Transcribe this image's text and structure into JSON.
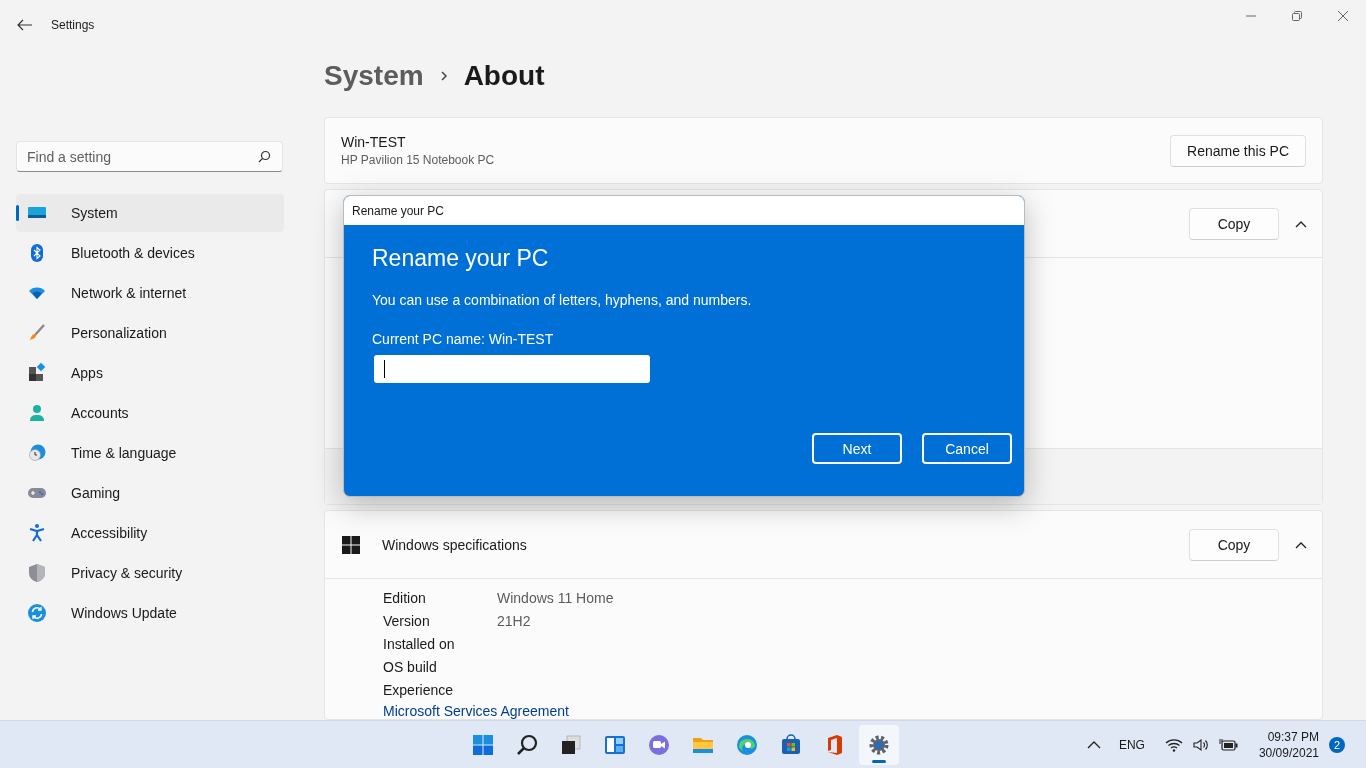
{
  "window": {
    "title": "Settings"
  },
  "search": {
    "placeholder": "Find a setting"
  },
  "sidebar": {
    "items": [
      {
        "label": "System",
        "kind": "system",
        "selected": true
      },
      {
        "label": "Bluetooth & devices",
        "kind": "bluetooth",
        "selected": false
      },
      {
        "label": "Network & internet",
        "kind": "network",
        "selected": false
      },
      {
        "label": "Personalization",
        "kind": "brush",
        "selected": false
      },
      {
        "label": "Apps",
        "kind": "apps",
        "selected": false
      },
      {
        "label": "Accounts",
        "kind": "accounts",
        "selected": false
      },
      {
        "label": "Time & language",
        "kind": "time",
        "selected": false
      },
      {
        "label": "Gaming",
        "kind": "gaming",
        "selected": false
      },
      {
        "label": "Accessibility",
        "kind": "accessibility",
        "selected": false
      },
      {
        "label": "Privacy & security",
        "kind": "privacy",
        "selected": false
      },
      {
        "label": "Windows Update",
        "kind": "update",
        "selected": false
      }
    ]
  },
  "breadcrumb": {
    "parent": "System",
    "current": "About"
  },
  "device_card": {
    "name": "Win-TEST",
    "model": "HP Pavilion 15 Notebook PC",
    "button": "Rename this PC"
  },
  "device_specs": {
    "button": "Copy",
    "expanded": true
  },
  "windows_specs": {
    "title": "Windows specifications",
    "button": "Copy",
    "expanded": true,
    "rows": [
      {
        "label": "Edition",
        "value": "Windows 11 Home"
      },
      {
        "label": "Version",
        "value": "21H2"
      },
      {
        "label": "Installed on"
      },
      {
        "label": "OS build"
      },
      {
        "label": "Experience"
      }
    ],
    "link": "Microsoft Services Agreement"
  },
  "dialog": {
    "title": "Rename your PC",
    "heading": "Rename your PC",
    "description": "You can use a combination of letters, hyphens, and numbers.",
    "current_name": "Current PC name: Win-TEST",
    "buttons": [
      "Next",
      "Cancel"
    ]
  },
  "taskbar": {
    "apps": [
      {
        "kind": "start",
        "active": false
      },
      {
        "kind": "search",
        "active": false
      },
      {
        "kind": "taskview",
        "active": false
      },
      {
        "kind": "widgets",
        "active": false
      },
      {
        "kind": "chat",
        "active": false
      },
      {
        "kind": "explorer",
        "active": false
      },
      {
        "kind": "edge",
        "active": false
      },
      {
        "kind": "store",
        "active": false
      },
      {
        "kind": "office",
        "active": false
      },
      {
        "kind": "settings",
        "active": true
      }
    ],
    "language": "ENG",
    "time": "09:37 PM",
    "date": "30/09/2021",
    "notifications": "2"
  }
}
